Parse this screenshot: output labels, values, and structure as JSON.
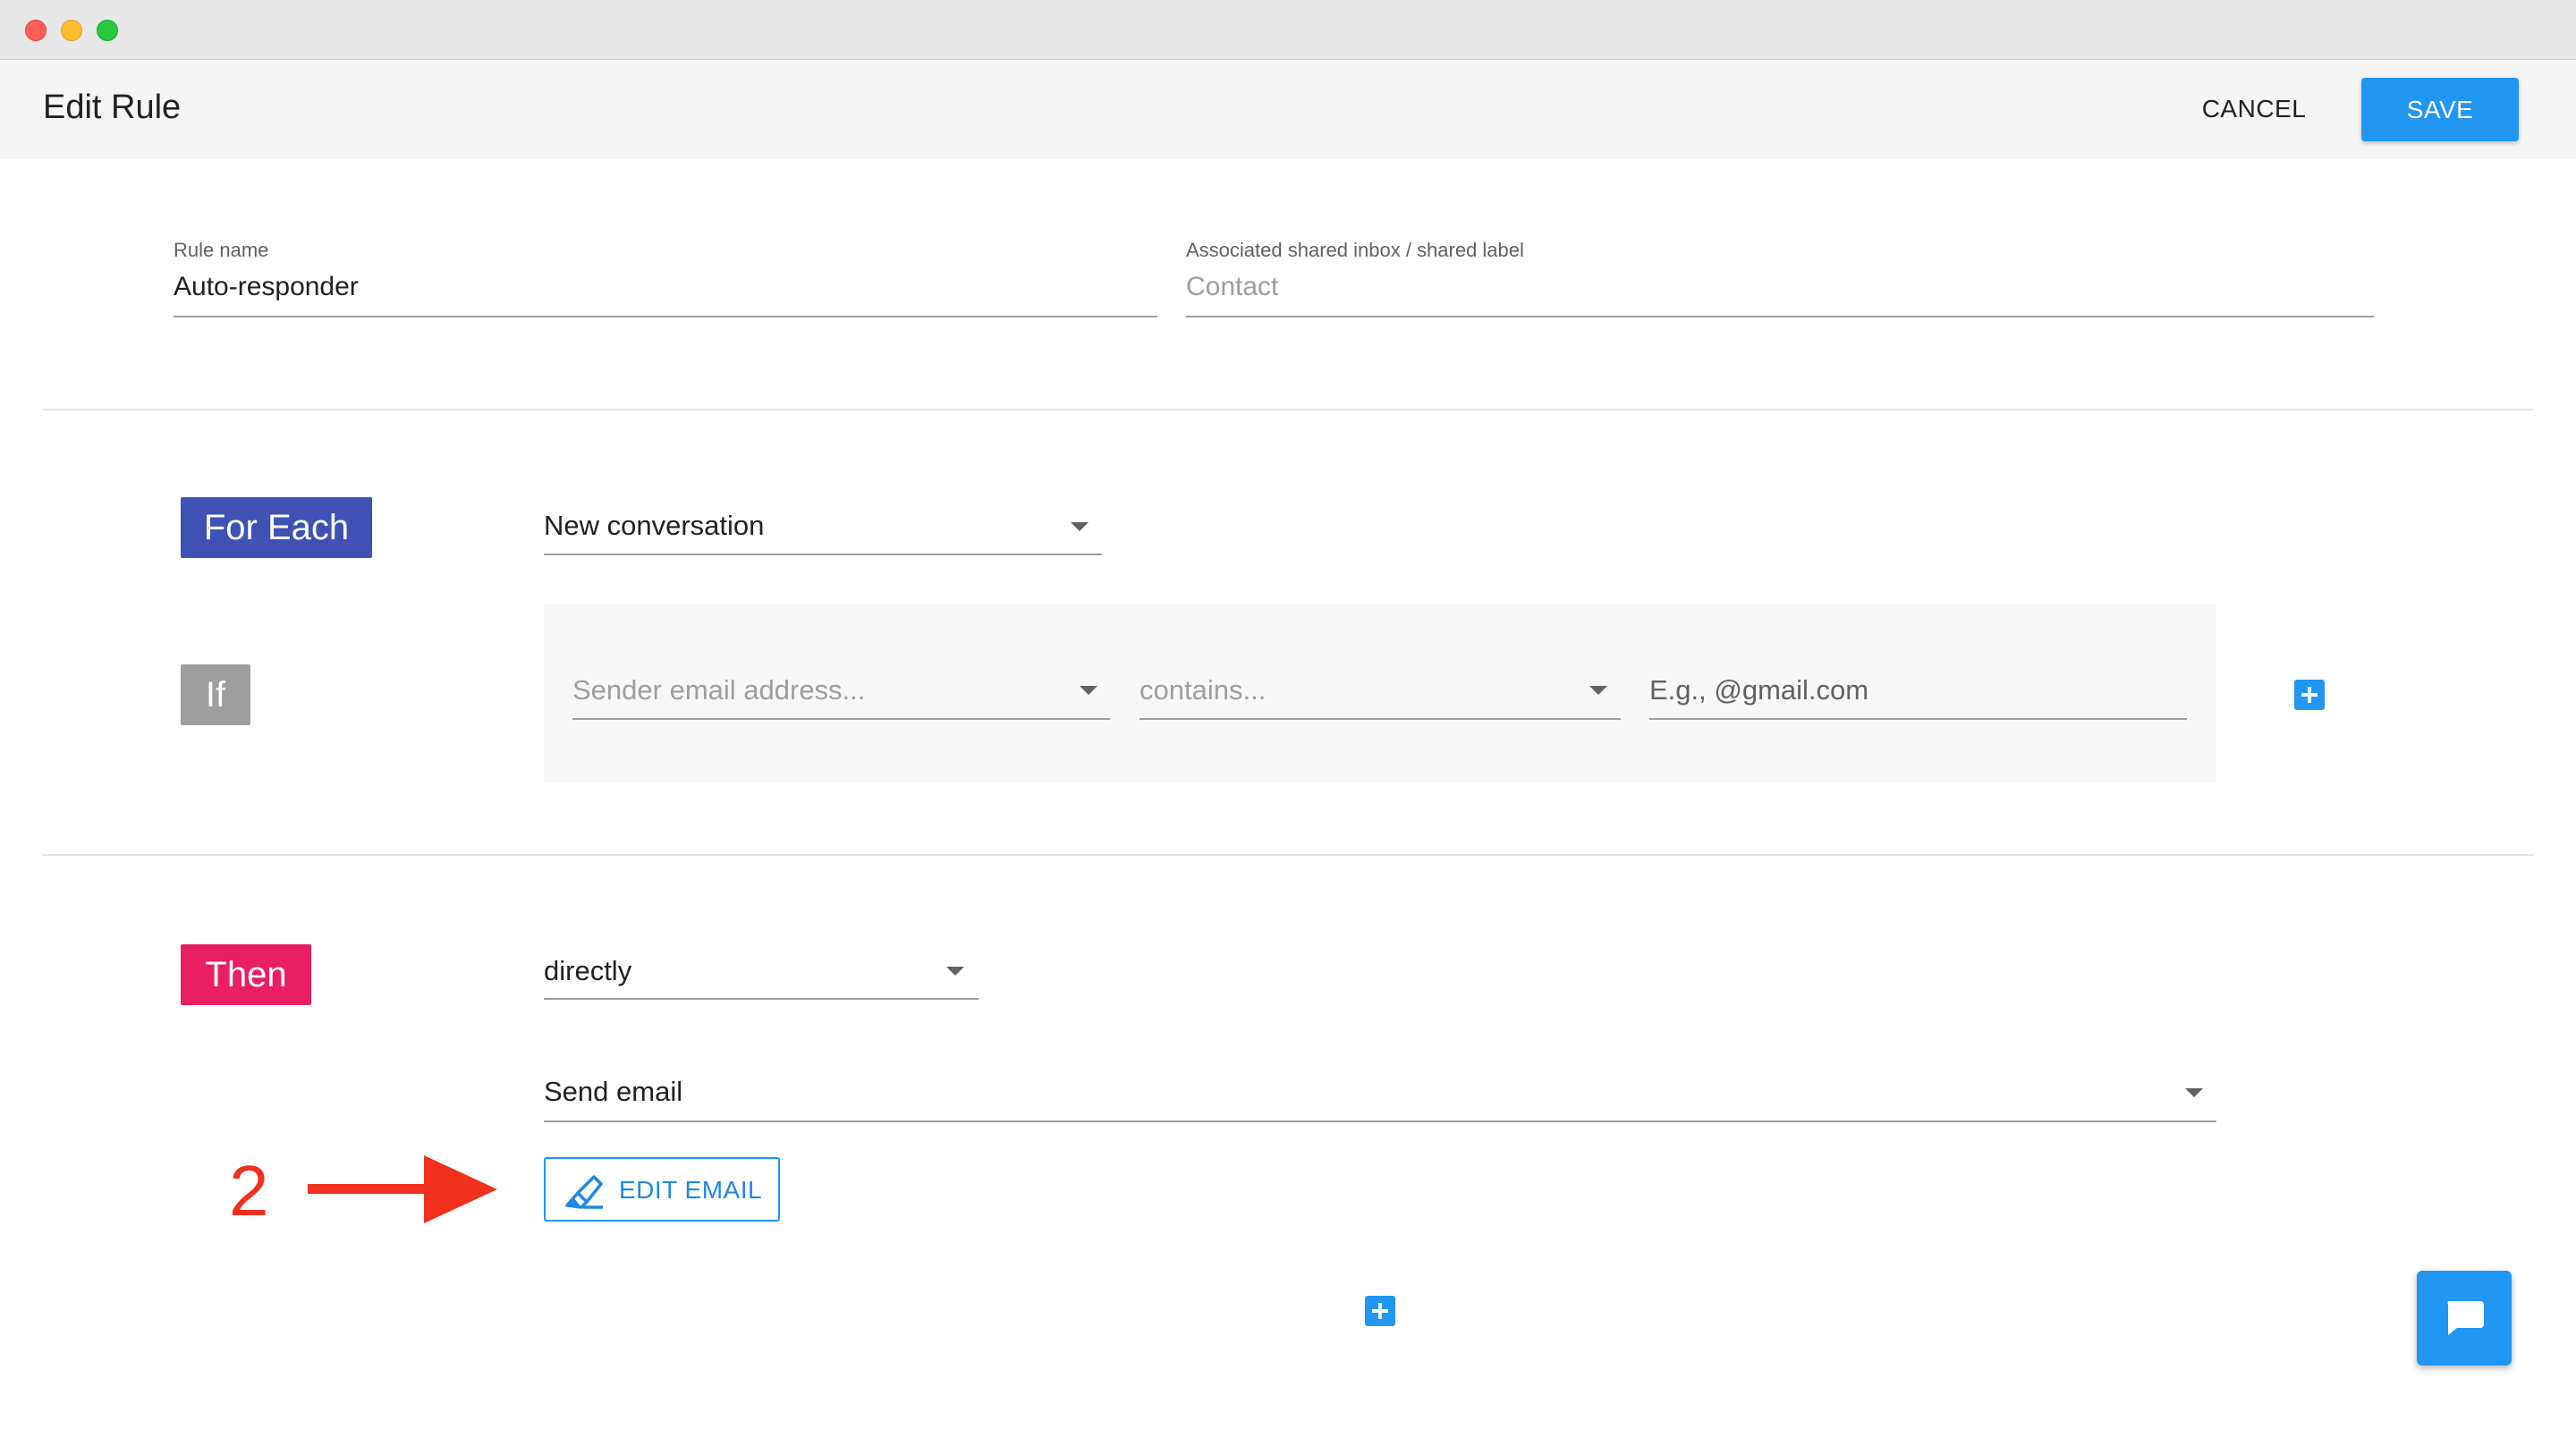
{
  "header": {
    "title": "Edit Rule",
    "cancel_label": "CANCEL",
    "save_label": "SAVE"
  },
  "rule_fields": {
    "name_label": "Rule name",
    "name_value": "Auto-responder",
    "inbox_label": "Associated shared inbox / shared label",
    "inbox_placeholder": "Contact"
  },
  "for_each": {
    "tag": "For Each",
    "trigger_value": "New conversation"
  },
  "condition": {
    "tag": "If",
    "field_placeholder": "Sender email address...",
    "operator_placeholder": "contains...",
    "value_placeholder": "E.g., @gmail.com",
    "add_icon": "plus-icon"
  },
  "then": {
    "tag": "Then",
    "timing_value": "directly",
    "action_value": "Send email",
    "edit_email_label": "EDIT EMAIL",
    "edit_email_icon": "edit-email-icon",
    "add_action_icon": "plus-icon"
  },
  "annotation": {
    "step_number": "2",
    "arrow_icon": "arrow-right-icon"
  },
  "chat": {
    "icon": "chat-bubble-icon"
  },
  "colors": {
    "primary": "#2196f3",
    "for_each_tag": "#3f51b5",
    "if_tag": "#9e9e9e",
    "then_tag": "#e91e63",
    "annotation": "#f2301e"
  }
}
